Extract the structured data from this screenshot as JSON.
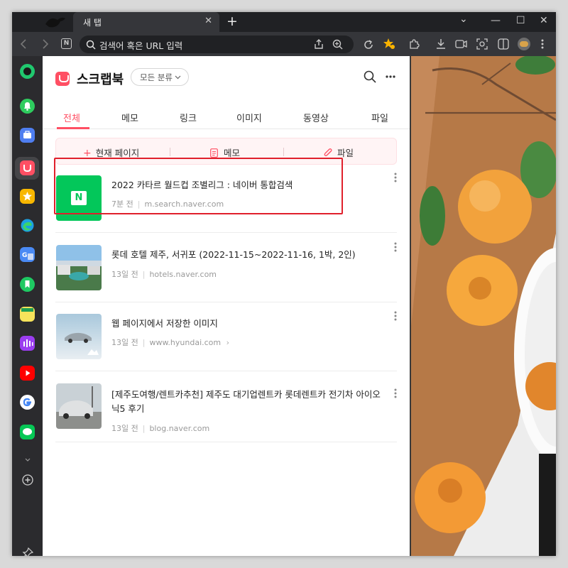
{
  "browser": {
    "tab_title": "새 탭",
    "tab_close": "✕",
    "new_tab": "+",
    "win_chevron": "⌄",
    "win_min": "—",
    "win_max": "☐",
    "win_close": "✕",
    "omnibox_text": "검색어 혹은 URL 입력",
    "n_badge": "N"
  },
  "panel": {
    "title": "스크랩북",
    "category": "모든 분류",
    "tabs": [
      {
        "label": "전체",
        "active": true
      },
      {
        "label": "메모"
      },
      {
        "label": "링크"
      },
      {
        "label": "이미지"
      },
      {
        "label": "동영상"
      },
      {
        "label": "파일"
      }
    ],
    "quick_actions": [
      {
        "icon": "plus-icon",
        "label": "현재 페이지"
      },
      {
        "icon": "memo-icon",
        "label": "메모"
      },
      {
        "icon": "paperclip-icon",
        "label": "파일"
      }
    ],
    "items": [
      {
        "title": "2022 카타르 월드컵 조별리그 : 네이버 통합검색",
        "time": "7분 전",
        "source": "m.search.naver.com",
        "thumb": "naver-logo",
        "thumb_text": "N"
      },
      {
        "title": "롯데 호텔 제주, 서귀포 (2022-11-15~2022-11-16, 1박, 2인)",
        "time": "13일 전",
        "source": "hotels.naver.com",
        "thumb": "hotel-photo"
      },
      {
        "title": "웹 페이지에서 저장한 이미지",
        "time": "13일 전",
        "source": "www.hyundai.com",
        "link_arrow": "›",
        "thumb": "car-photo"
      },
      {
        "title": "[제주도여행/렌트카추천] 제주도 대기업렌트카 롯데렌트카 전기차 아이오닉5 후기",
        "time": "13일 전",
        "source": "blog.naver.com",
        "thumb": "car-street-photo"
      }
    ]
  },
  "colors": {
    "accent": "#ff4f63",
    "highlight": "#e0202c",
    "naver_green": "#03c75a"
  }
}
